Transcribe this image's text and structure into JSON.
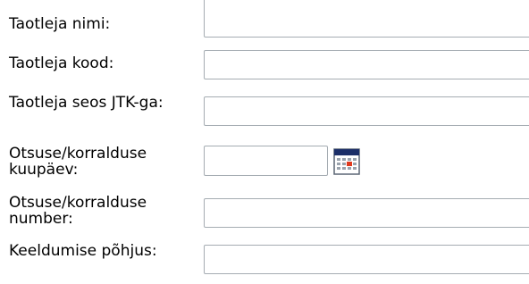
{
  "form": {
    "fields": [
      {
        "label": "Taotleja nimi:",
        "value": ""
      },
      {
        "label": "Taotleja kood:",
        "value": ""
      },
      {
        "label": "Taotleja seos JTK-ga:",
        "value": ""
      },
      {
        "label": "Otsuse/korralduse kuupäev:",
        "value": ""
      },
      {
        "label": "Otsuse/korralduse number:",
        "value": ""
      },
      {
        "label": "Keeldumise põhjus:",
        "value": ""
      }
    ]
  },
  "icons": {
    "date_picker": "calendar-icon"
  },
  "colors": {
    "input_border": "#a5acb2",
    "calendar_header": "#1c2f68",
    "calendar_highlight": "#e03a1e"
  }
}
